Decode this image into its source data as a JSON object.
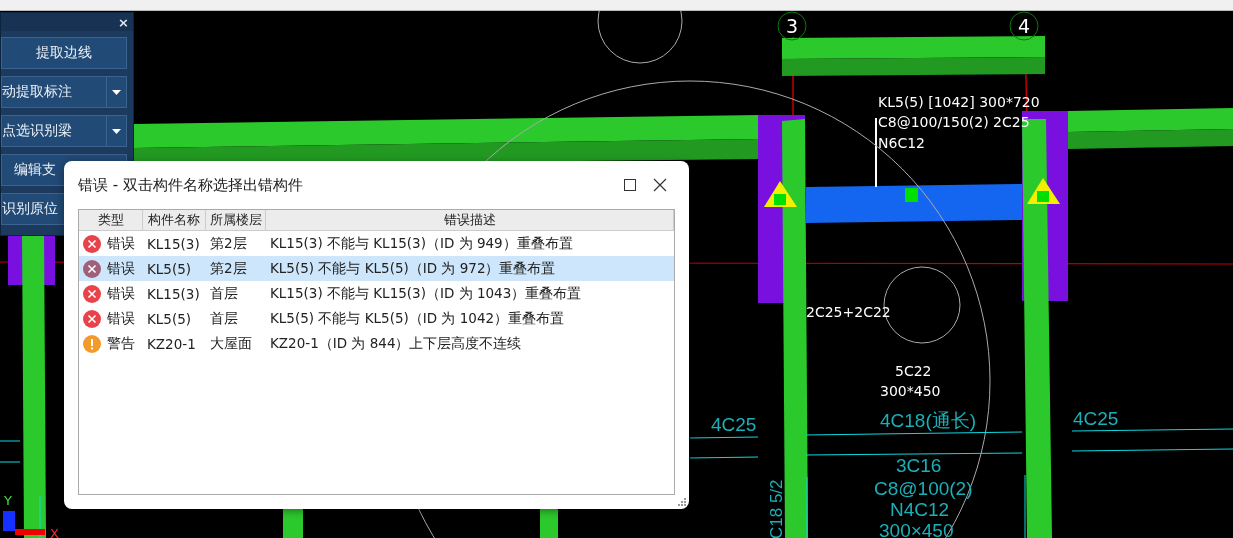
{
  "tool_panel": {
    "close": "×",
    "buttons": [
      {
        "label": "提取边线",
        "kind": "plain"
      },
      {
        "label": "动提取标注",
        "kind": "dropdown"
      },
      {
        "label": "点选识别梁",
        "kind": "dropdown"
      },
      {
        "label": "编辑支",
        "kind": "plain"
      },
      {
        "label": "识别原位",
        "kind": "plain"
      }
    ]
  },
  "canvas": {
    "axis_markers": [
      "3",
      "4"
    ],
    "annotations": [
      {
        "text": "KL5(5) [1042] 300*720",
        "color": "#ffffff"
      },
      {
        "text": "C8@100/150(2) 2C25",
        "color": "#ffffff"
      },
      {
        "text": "N6C12",
        "color": "#ffffff"
      },
      {
        "text": "2C25+2C22",
        "color": "#ffffff"
      },
      {
        "text": "5C22",
        "color": "#ffffff"
      },
      {
        "text": "300*450",
        "color": "#ffffff"
      },
      {
        "text": "4C25",
        "color": "#1ab0b8"
      },
      {
        "text": "4C18(通长)",
        "color": "#1ab0b8"
      },
      {
        "text": "4C25",
        "color": "#1ab0b8"
      },
      {
        "text": "3C16",
        "color": "#1ab0b8"
      },
      {
        "text": "C8@100(2)",
        "color": "#1ab0b8"
      },
      {
        "text": "N4C12",
        "color": "#1ab0b8"
      },
      {
        "text": "300×450",
        "color": "#1ab0b8"
      },
      {
        "text": "C18 5/2",
        "color": "#1ab0b8"
      }
    ],
    "ucs": {
      "y": "Y",
      "x": "X"
    }
  },
  "dialog": {
    "title": "错误 - 双击构件名称选择出错构件",
    "columns": [
      "类型",
      "构件名称",
      "所属楼层",
      "错误描述"
    ],
    "rows": [
      {
        "kind": "error",
        "type": "错误",
        "name": "KL15(3)",
        "floor": "第2层",
        "description": "KL15(3) 不能与 KL15(3)（ID 为 949）重叠布置",
        "selected": false
      },
      {
        "kind": "error",
        "type": "错误",
        "name": "KL5(5)",
        "floor": "第2层",
        "description": "KL5(5) 不能与 KL5(5)（ID 为 972）重叠布置",
        "selected": true
      },
      {
        "kind": "error",
        "type": "错误",
        "name": "KL15(3)",
        "floor": "首层",
        "description": "KL15(3) 不能与 KL15(3)（ID 为 1043）重叠布置",
        "selected": false
      },
      {
        "kind": "error",
        "type": "错误",
        "name": "KL5(5)",
        "floor": "首层",
        "description": "KL5(5) 不能与 KL5(5)（ID 为 1042）重叠布置",
        "selected": false
      },
      {
        "kind": "warning",
        "type": "警告",
        "name": "KZ20-1",
        "floor": "大屋面",
        "description": "KZ20-1（ID 为 844）上下层高度不连续",
        "selected": false
      }
    ]
  }
}
